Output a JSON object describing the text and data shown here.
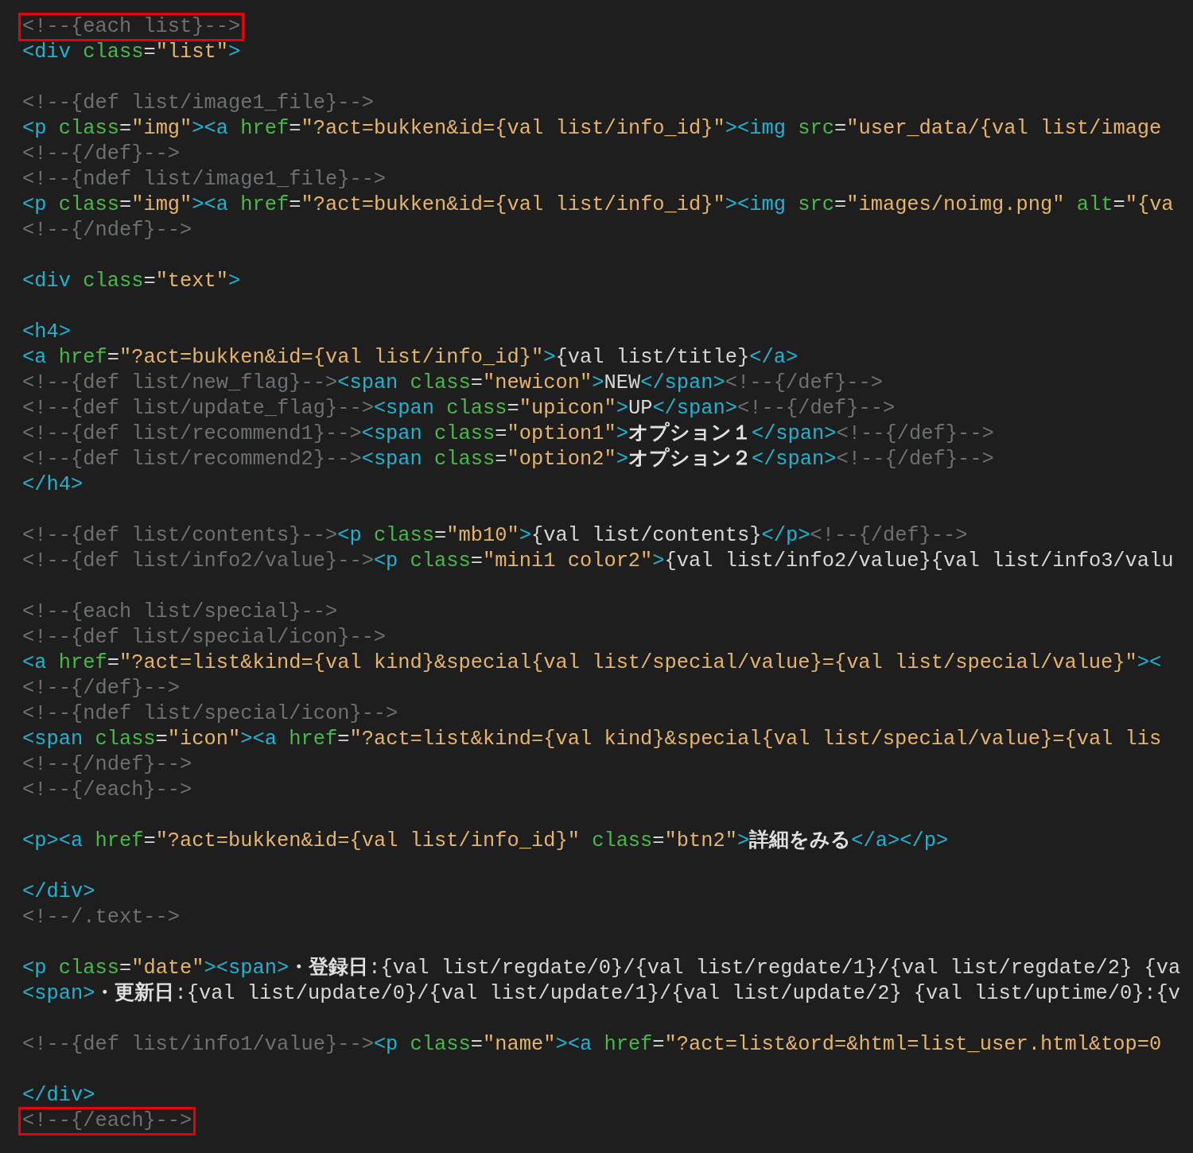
{
  "editor": {
    "blocks": [
      {
        "lines": [
          {
            "highlighted": true,
            "tokens": [
              {
                "kind": "comment",
                "text": "<!--{each list}-->"
              }
            ]
          },
          {
            "highlighted": false,
            "tokens": [
              {
                "kind": "tag",
                "text": "<div"
              },
              {
                "kind": "attr",
                "text": " class"
              },
              {
                "kind": "text",
                "text": "="
              },
              {
                "kind": "string",
                "text": "\"list\""
              },
              {
                "kind": "tag",
                "text": ">"
              }
            ]
          }
        ]
      },
      {
        "lines": [
          {
            "highlighted": false,
            "tokens": [
              {
                "kind": "comment",
                "text": "<!--{def list/image1_file}-->"
              }
            ]
          },
          {
            "highlighted": false,
            "tokens": [
              {
                "kind": "tag",
                "text": "<p"
              },
              {
                "kind": "attr",
                "text": " class"
              },
              {
                "kind": "text",
                "text": "="
              },
              {
                "kind": "string",
                "text": "\"img\""
              },
              {
                "kind": "tag",
                "text": "><a"
              },
              {
                "kind": "attr",
                "text": " href"
              },
              {
                "kind": "text",
                "text": "="
              },
              {
                "kind": "string",
                "text": "\"?act=bukken&id={val list/info_id}\""
              },
              {
                "kind": "tag",
                "text": "><img"
              },
              {
                "kind": "attr",
                "text": " src"
              },
              {
                "kind": "text",
                "text": "="
              },
              {
                "kind": "string",
                "text": "\"user_data/{val list/image"
              }
            ]
          },
          {
            "highlighted": false,
            "tokens": [
              {
                "kind": "comment",
                "text": "<!--{/def}-->"
              }
            ]
          },
          {
            "highlighted": false,
            "tokens": [
              {
                "kind": "comment",
                "text": "<!--{ndef list/image1_file}-->"
              }
            ]
          },
          {
            "highlighted": false,
            "tokens": [
              {
                "kind": "tag",
                "text": "<p"
              },
              {
                "kind": "attr",
                "text": " class"
              },
              {
                "kind": "text",
                "text": "="
              },
              {
                "kind": "string",
                "text": "\"img\""
              },
              {
                "kind": "tag",
                "text": "><a"
              },
              {
                "kind": "attr",
                "text": " href"
              },
              {
                "kind": "text",
                "text": "="
              },
              {
                "kind": "string",
                "text": "\"?act=bukken&id={val list/info_id}\""
              },
              {
                "kind": "tag",
                "text": "><img"
              },
              {
                "kind": "attr",
                "text": " src"
              },
              {
                "kind": "text",
                "text": "="
              },
              {
                "kind": "string",
                "text": "\"images/noimg.png\""
              },
              {
                "kind": "attr",
                "text": " alt"
              },
              {
                "kind": "text",
                "text": "="
              },
              {
                "kind": "string",
                "text": "\"{va"
              }
            ]
          },
          {
            "highlighted": false,
            "tokens": [
              {
                "kind": "comment",
                "text": "<!--{/ndef}-->"
              }
            ]
          }
        ]
      },
      {
        "lines": [
          {
            "highlighted": false,
            "tokens": [
              {
                "kind": "tag",
                "text": "<div"
              },
              {
                "kind": "attr",
                "text": " class"
              },
              {
                "kind": "text",
                "text": "="
              },
              {
                "kind": "string",
                "text": "\"text\""
              },
              {
                "kind": "tag",
                "text": ">"
              }
            ]
          }
        ]
      },
      {
        "lines": [
          {
            "highlighted": false,
            "tokens": [
              {
                "kind": "tag",
                "text": "<h4>"
              }
            ]
          },
          {
            "highlighted": false,
            "tokens": [
              {
                "kind": "tag",
                "text": "<a"
              },
              {
                "kind": "attr",
                "text": " href"
              },
              {
                "kind": "text",
                "text": "="
              },
              {
                "kind": "string",
                "text": "\"?act=bukken&id={val list/info_id}\""
              },
              {
                "kind": "tag",
                "text": ">"
              },
              {
                "kind": "text",
                "text": "{val list/title}"
              },
              {
                "kind": "tag",
                "text": "</a>"
              }
            ]
          },
          {
            "highlighted": false,
            "tokens": [
              {
                "kind": "comment",
                "text": "<!--{def list/new_flag}-->"
              },
              {
                "kind": "tag",
                "text": "<span"
              },
              {
                "kind": "attr",
                "text": " class"
              },
              {
                "kind": "text",
                "text": "="
              },
              {
                "kind": "string",
                "text": "\"newicon\""
              },
              {
                "kind": "tag",
                "text": ">"
              },
              {
                "kind": "text",
                "text": "NEW"
              },
              {
                "kind": "tag",
                "text": "</span>"
              },
              {
                "kind": "comment",
                "text": "<!--{/def}-->"
              }
            ]
          },
          {
            "highlighted": false,
            "tokens": [
              {
                "kind": "comment",
                "text": "<!--{def list/update_flag}-->"
              },
              {
                "kind": "tag",
                "text": "<span"
              },
              {
                "kind": "attr",
                "text": " class"
              },
              {
                "kind": "text",
                "text": "="
              },
              {
                "kind": "string",
                "text": "\"upicon\""
              },
              {
                "kind": "tag",
                "text": ">"
              },
              {
                "kind": "text",
                "text": "UP"
              },
              {
                "kind": "tag",
                "text": "</span>"
              },
              {
                "kind": "comment",
                "text": "<!--{/def}-->"
              }
            ]
          },
          {
            "highlighted": false,
            "tokens": [
              {
                "kind": "comment",
                "text": "<!--{def list/recommend1}-->"
              },
              {
                "kind": "tag",
                "text": "<span"
              },
              {
                "kind": "attr",
                "text": " class"
              },
              {
                "kind": "text",
                "text": "="
              },
              {
                "kind": "string",
                "text": "\"option1\""
              },
              {
                "kind": "tag",
                "text": ">"
              },
              {
                "kind": "bold",
                "text": "オプション１"
              },
              {
                "kind": "tag",
                "text": "</span>"
              },
              {
                "kind": "comment",
                "text": "<!--{/def}-->"
              }
            ]
          },
          {
            "highlighted": false,
            "tokens": [
              {
                "kind": "comment",
                "text": "<!--{def list/recommend2}-->"
              },
              {
                "kind": "tag",
                "text": "<span"
              },
              {
                "kind": "attr",
                "text": " class"
              },
              {
                "kind": "text",
                "text": "="
              },
              {
                "kind": "string",
                "text": "\"option2\""
              },
              {
                "kind": "tag",
                "text": ">"
              },
              {
                "kind": "bold",
                "text": "オプション２"
              },
              {
                "kind": "tag",
                "text": "</span>"
              },
              {
                "kind": "comment",
                "text": "<!--{/def}-->"
              }
            ]
          },
          {
            "highlighted": false,
            "tokens": [
              {
                "kind": "tag",
                "text": "</h4>"
              }
            ]
          }
        ]
      },
      {
        "lines": [
          {
            "highlighted": false,
            "tokens": [
              {
                "kind": "comment",
                "text": "<!--{def list/contents}-->"
              },
              {
                "kind": "tag",
                "text": "<p"
              },
              {
                "kind": "attr",
                "text": " class"
              },
              {
                "kind": "text",
                "text": "="
              },
              {
                "kind": "string",
                "text": "\"mb10\""
              },
              {
                "kind": "tag",
                "text": ">"
              },
              {
                "kind": "text",
                "text": "{val list/contents}"
              },
              {
                "kind": "tag",
                "text": "</p>"
              },
              {
                "kind": "comment",
                "text": "<!--{/def}-->"
              }
            ]
          },
          {
            "highlighted": false,
            "tokens": [
              {
                "kind": "comment",
                "text": "<!--{def list/info2/value}-->"
              },
              {
                "kind": "tag",
                "text": "<p"
              },
              {
                "kind": "attr",
                "text": " class"
              },
              {
                "kind": "text",
                "text": "="
              },
              {
                "kind": "string",
                "text": "\"mini1 color2\""
              },
              {
                "kind": "tag",
                "text": ">"
              },
              {
                "kind": "text",
                "text": "{val list/info2/value}{val list/info3/valu"
              }
            ]
          }
        ]
      },
      {
        "lines": [
          {
            "highlighted": false,
            "tokens": [
              {
                "kind": "comment",
                "text": "<!--{each list/special}-->"
              }
            ]
          },
          {
            "highlighted": false,
            "tokens": [
              {
                "kind": "comment",
                "text": "<!--{def list/special/icon}-->"
              }
            ]
          },
          {
            "highlighted": false,
            "tokens": [
              {
                "kind": "tag",
                "text": "<a"
              },
              {
                "kind": "attr",
                "text": " href"
              },
              {
                "kind": "text",
                "text": "="
              },
              {
                "kind": "string",
                "text": "\"?act=list&kind={val kind}&special{val list/special/value}={val list/special/value}\""
              },
              {
                "kind": "tag",
                "text": "><"
              }
            ]
          },
          {
            "highlighted": false,
            "tokens": [
              {
                "kind": "comment",
                "text": "<!--{/def}-->"
              }
            ]
          },
          {
            "highlighted": false,
            "tokens": [
              {
                "kind": "comment",
                "text": "<!--{ndef list/special/icon}-->"
              }
            ]
          },
          {
            "highlighted": false,
            "tokens": [
              {
                "kind": "tag",
                "text": "<span"
              },
              {
                "kind": "attr",
                "text": " class"
              },
              {
                "kind": "text",
                "text": "="
              },
              {
                "kind": "string",
                "text": "\"icon\""
              },
              {
                "kind": "tag",
                "text": "><a"
              },
              {
                "kind": "attr",
                "text": " href"
              },
              {
                "kind": "text",
                "text": "="
              },
              {
                "kind": "string",
                "text": "\"?act=list&kind={val kind}&special{val list/special/value}={val lis"
              }
            ]
          },
          {
            "highlighted": false,
            "tokens": [
              {
                "kind": "comment",
                "text": "<!--{/ndef}-->"
              }
            ]
          },
          {
            "highlighted": false,
            "tokens": [
              {
                "kind": "comment",
                "text": "<!--{/each}-->"
              }
            ]
          }
        ]
      },
      {
        "lines": [
          {
            "highlighted": false,
            "tokens": [
              {
                "kind": "tag",
                "text": "<p><a"
              },
              {
                "kind": "attr",
                "text": " href"
              },
              {
                "kind": "text",
                "text": "="
              },
              {
                "kind": "string",
                "text": "\"?act=bukken&id={val list/info_id}\""
              },
              {
                "kind": "attr",
                "text": " class"
              },
              {
                "kind": "text",
                "text": "="
              },
              {
                "kind": "string",
                "text": "\"btn2\""
              },
              {
                "kind": "tag",
                "text": ">"
              },
              {
                "kind": "bold",
                "text": "詳細をみる"
              },
              {
                "kind": "tag",
                "text": "</a></p>"
              }
            ]
          }
        ]
      },
      {
        "lines": [
          {
            "highlighted": false,
            "tokens": [
              {
                "kind": "tag",
                "text": "</div>"
              }
            ]
          },
          {
            "highlighted": false,
            "tokens": [
              {
                "kind": "comment",
                "text": "<!--/.text-->"
              }
            ]
          }
        ]
      },
      {
        "lines": [
          {
            "highlighted": false,
            "tokens": [
              {
                "kind": "tag",
                "text": "<p"
              },
              {
                "kind": "attr",
                "text": " class"
              },
              {
                "kind": "text",
                "text": "="
              },
              {
                "kind": "string",
                "text": "\"date\""
              },
              {
                "kind": "tag",
                "text": "><span>"
              },
              {
                "kind": "bold",
                "text": "・登録日"
              },
              {
                "kind": "text",
                "text": ":{val list/regdate/0}/{val list/regdate/1}/{val list/regdate/2} {va"
              }
            ]
          },
          {
            "highlighted": false,
            "tokens": [
              {
                "kind": "tag",
                "text": "<span>"
              },
              {
                "kind": "bold",
                "text": "・更新日"
              },
              {
                "kind": "text",
                "text": ":{val list/update/0}/{val list/update/1}/{val list/update/2} {val list/uptime/0}:{v"
              }
            ]
          }
        ]
      },
      {
        "lines": [
          {
            "highlighted": false,
            "tokens": [
              {
                "kind": "comment",
                "text": "<!--{def list/info1/value}-->"
              },
              {
                "kind": "tag",
                "text": "<p"
              },
              {
                "kind": "attr",
                "text": " class"
              },
              {
                "kind": "text",
                "text": "="
              },
              {
                "kind": "string",
                "text": "\"name\""
              },
              {
                "kind": "tag",
                "text": "><a"
              },
              {
                "kind": "attr",
                "text": " href"
              },
              {
                "kind": "text",
                "text": "="
              },
              {
                "kind": "string",
                "text": "\"?act=list&ord=&html=list_user.html&top=0"
              }
            ]
          }
        ]
      },
      {
        "lines": [
          {
            "highlighted": false,
            "tokens": [
              {
                "kind": "tag",
                "text": "</div>"
              }
            ]
          },
          {
            "highlighted": true,
            "tokens": [
              {
                "kind": "comment",
                "text": "<!--{/each}-->"
              }
            ]
          }
        ]
      }
    ]
  }
}
